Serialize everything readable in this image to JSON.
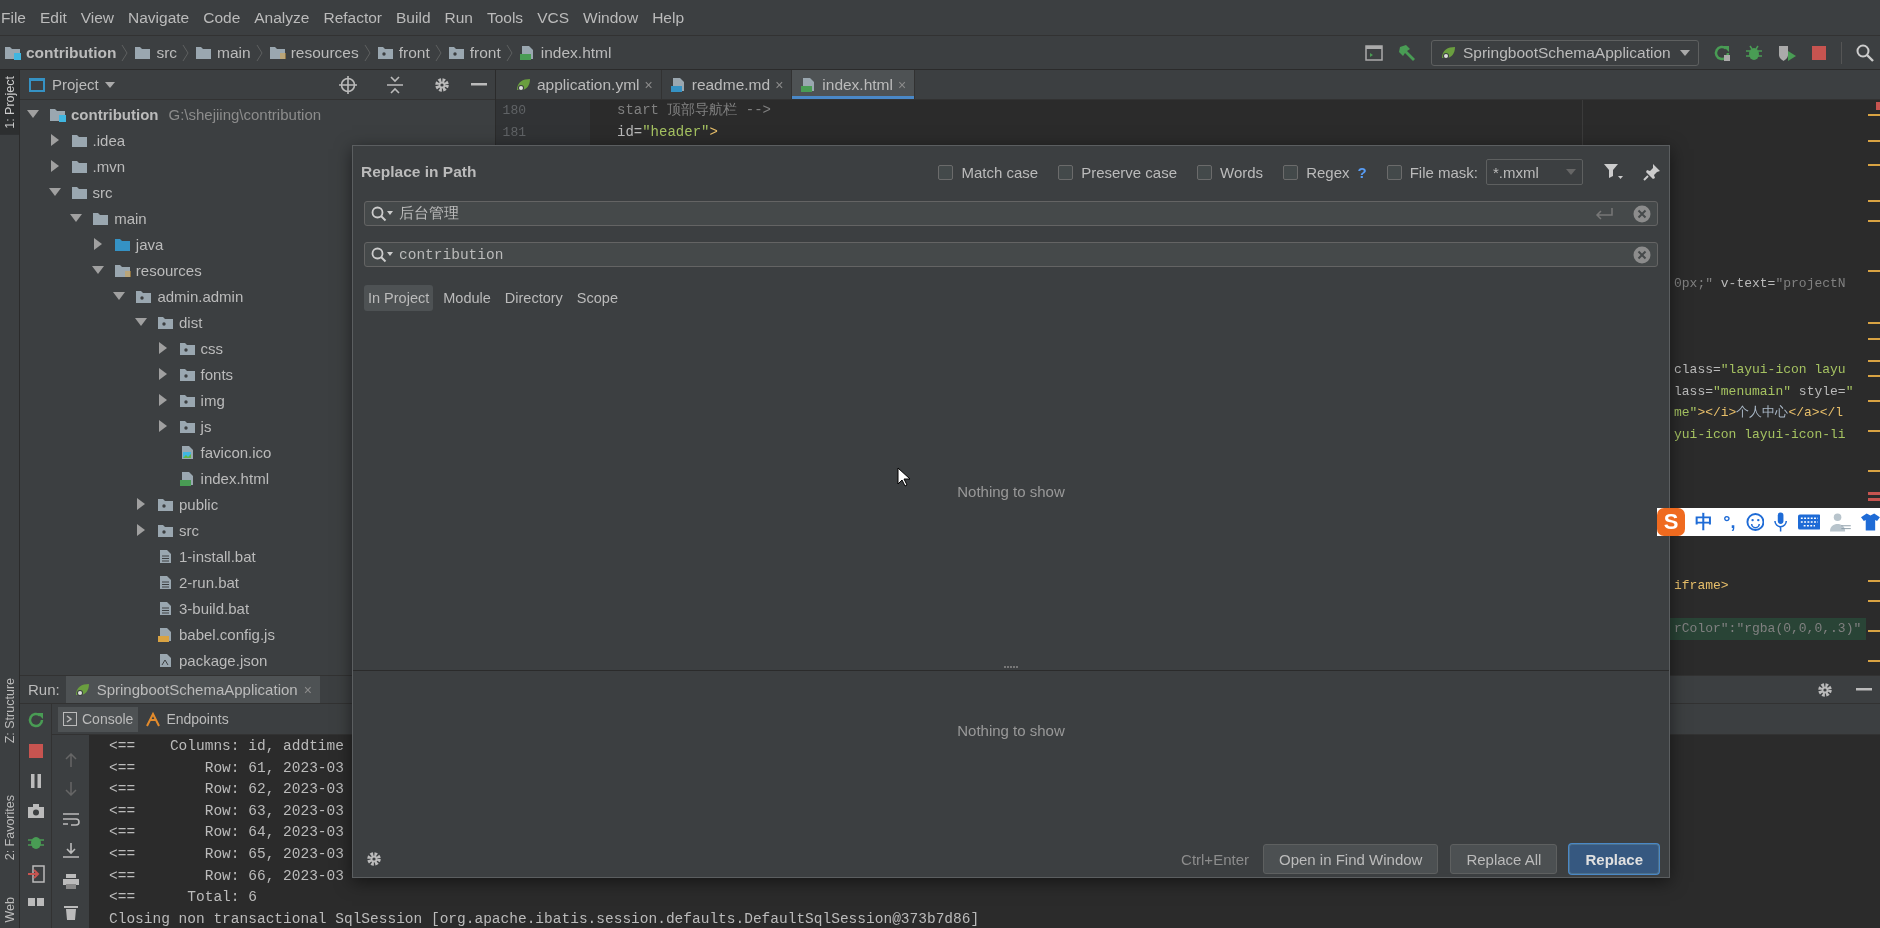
{
  "menu_bar": {
    "items": [
      "File",
      "Edit",
      "View",
      "Navigate",
      "Code",
      "Analyze",
      "Refactor",
      "Build",
      "Run",
      "Tools",
      "VCS",
      "Window",
      "Help"
    ]
  },
  "navigation_bar": {
    "breadcrumbs": [
      {
        "label": "contribution",
        "kind": "module"
      },
      {
        "label": "src",
        "kind": "folder"
      },
      {
        "label": "main",
        "kind": "folder"
      },
      {
        "label": "resources",
        "kind": "resources"
      },
      {
        "label": "front",
        "kind": "web"
      },
      {
        "label": "front",
        "kind": "web"
      },
      {
        "label": "index.html",
        "kind": "html"
      }
    ],
    "run_configuration": "SpringbootSchemaApplication"
  },
  "tool_stripe": {
    "tabs": [
      {
        "label": "1: Project",
        "selected": true
      },
      {
        "label": "Z: Structure",
        "selected": false
      },
      {
        "label": "2: Favorites",
        "selected": false
      },
      {
        "label": "Web",
        "selected": false
      }
    ]
  },
  "project_panel": {
    "title": "Project",
    "tree": [
      {
        "label": "contribution",
        "path": "G:\\shejiing\\contribution",
        "kind": "module",
        "expanded": true,
        "children": [
          {
            "label": ".idea",
            "kind": "folder",
            "expanded": false
          },
          {
            "label": ".mvn",
            "kind": "folder",
            "expanded": false
          },
          {
            "label": "src",
            "kind": "folder",
            "expanded": true,
            "children": [
              {
                "label": "main",
                "kind": "folder",
                "expanded": true,
                "children": [
                  {
                    "label": "java",
                    "kind": "source",
                    "expanded": false
                  },
                  {
                    "label": "resources",
                    "kind": "resources",
                    "expanded": true,
                    "children": [
                      {
                        "label": "admin.admin",
                        "kind": "web",
                        "expanded": true,
                        "children": [
                          {
                            "label": "dist",
                            "kind": "web",
                            "expanded": true,
                            "children": [
                              {
                                "label": "css",
                                "kind": "web",
                                "expanded": false
                              },
                              {
                                "label": "fonts",
                                "kind": "web",
                                "expanded": false
                              },
                              {
                                "label": "img",
                                "kind": "web",
                                "expanded": false
                              },
                              {
                                "label": "js",
                                "kind": "web",
                                "expanded": false
                              },
                              {
                                "label": "favicon.ico",
                                "kind": "ico"
                              },
                              {
                                "label": "index.html",
                                "kind": "html"
                              }
                            ]
                          },
                          {
                            "label": "public",
                            "kind": "web",
                            "expanded": false
                          },
                          {
                            "label": "src",
                            "kind": "web",
                            "expanded": false
                          },
                          {
                            "label": "1-install.bat",
                            "kind": "bat"
                          },
                          {
                            "label": "2-run.bat",
                            "kind": "bat"
                          },
                          {
                            "label": "3-build.bat",
                            "kind": "bat"
                          },
                          {
                            "label": "babel.config.js",
                            "kind": "js"
                          },
                          {
                            "label": "package.json",
                            "kind": "json"
                          }
                        ]
                      }
                    ]
                  }
                ]
              }
            ]
          }
        ]
      }
    ]
  },
  "editor": {
    "tabs": [
      {
        "label": "application.yml",
        "kind": "yaml",
        "close": "×",
        "selected": false
      },
      {
        "label": "readme.md",
        "kind": "markdown",
        "close": "×",
        "selected": false
      },
      {
        "label": "index.html",
        "kind": "html",
        "close": "×",
        "selected": true
      }
    ],
    "lines": [
      {
        "number": "180",
        "parts": [
          {
            "kind": "comment",
            "text": "start 顶部导航栏 -->"
          }
        ]
      },
      {
        "number": "181",
        "parts": [
          {
            "kind": "attr",
            "text": "id="
          },
          {
            "kind": "string",
            "text": "\"header\""
          },
          {
            "kind": "tag",
            "text": ">"
          }
        ]
      }
    ],
    "fragments": [
      {
        "changed": false,
        "parts": [
          {
            "kind": "comment",
            "text": "0px;\""
          },
          {
            "kind": "attr",
            "text": " v-text="
          },
          {
            "kind": "comment",
            "text": "\"projectN"
          }
        ]
      },
      {
        "changed": false,
        "parts": [
          {
            "kind": "attr",
            "text": "class="
          },
          {
            "kind": "string",
            "text": "\"layui-icon layu"
          }
        ]
      },
      {
        "changed": false,
        "parts": [
          {
            "kind": "attr",
            "text": "lass="
          },
          {
            "kind": "string",
            "text": "\"menumain\""
          },
          {
            "kind": "attr",
            "text": " style="
          },
          {
            "kind": "string",
            "text": "\""
          }
        ]
      },
      {
        "changed": false,
        "parts": [
          {
            "kind": "string",
            "text": "me\""
          },
          {
            "kind": "tag",
            "text": "></i>"
          },
          {
            "kind": "text",
            "text": "个人中心"
          },
          {
            "kind": "tag",
            "text": "</a></l"
          }
        ]
      },
      {
        "changed": false,
        "parts": [
          {
            "kind": "string",
            "text": "yui-icon layui-icon-li"
          }
        ]
      },
      {
        "changed": false,
        "parts": [
          {
            "kind": "tag",
            "text": "iframe>"
          }
        ]
      },
      {
        "changed": true,
        "parts": [
          {
            "kind": "comment",
            "text": "rColor\":\"rgba(0,0,0,.3)\""
          }
        ]
      }
    ]
  },
  "ime_toolbar": {
    "logo": "S",
    "mode": "中",
    "punctuation": "°,"
  },
  "run_panel": {
    "title": "Run:",
    "tab": "SpringbootSchemaApplication",
    "tab_close": "×",
    "console_tabs": [
      {
        "label": "Console",
        "selected": true
      },
      {
        "label": "Endpoints",
        "selected": false
      }
    ],
    "lines": [
      "<==    Columns: id, addtime",
      "<==        Row: 61, 2023-03",
      "<==        Row: 62, 2023-03",
      "<==        Row: 63, 2023-03",
      "<==        Row: 64, 2023-03",
      "<==        Row: 65, 2023-03",
      "<==        Row: 66, 2023-03",
      "<==      Total: 6",
      "Closing non transactional SqlSession [org.apache.ibatis.session.defaults.DefaultSqlSession@373b7d86]"
    ]
  },
  "dialog": {
    "title": "Replace in Path",
    "options": [
      {
        "label": "Match case",
        "kind": "plain",
        "checked": false
      },
      {
        "label": "Preserve case",
        "kind": "plain",
        "checked": false
      },
      {
        "label": "Words",
        "kind": "plain",
        "checked": false
      },
      {
        "label": "Regex",
        "kind": "help",
        "help": "?",
        "checked": false
      },
      {
        "label": "File mask:",
        "kind": "mask",
        "value": "*.mxml",
        "checked": false
      }
    ],
    "search": {
      "value": "后台管理"
    },
    "replace": {
      "value": "contribution"
    },
    "scopes": [
      {
        "label": "In Project",
        "selected": true
      },
      {
        "label": "Module",
        "selected": false
      },
      {
        "label": "Directory",
        "selected": false
      },
      {
        "label": "Scope",
        "selected": false
      }
    ],
    "results_message": "Nothing to show",
    "preview_message": "Nothing to show",
    "shortcut": "Ctrl+Enter",
    "buttons": [
      {
        "label": "Open in Find Window",
        "default": false
      },
      {
        "label": "Replace All",
        "default": false
      },
      {
        "label": "Replace",
        "default": true
      }
    ]
  }
}
